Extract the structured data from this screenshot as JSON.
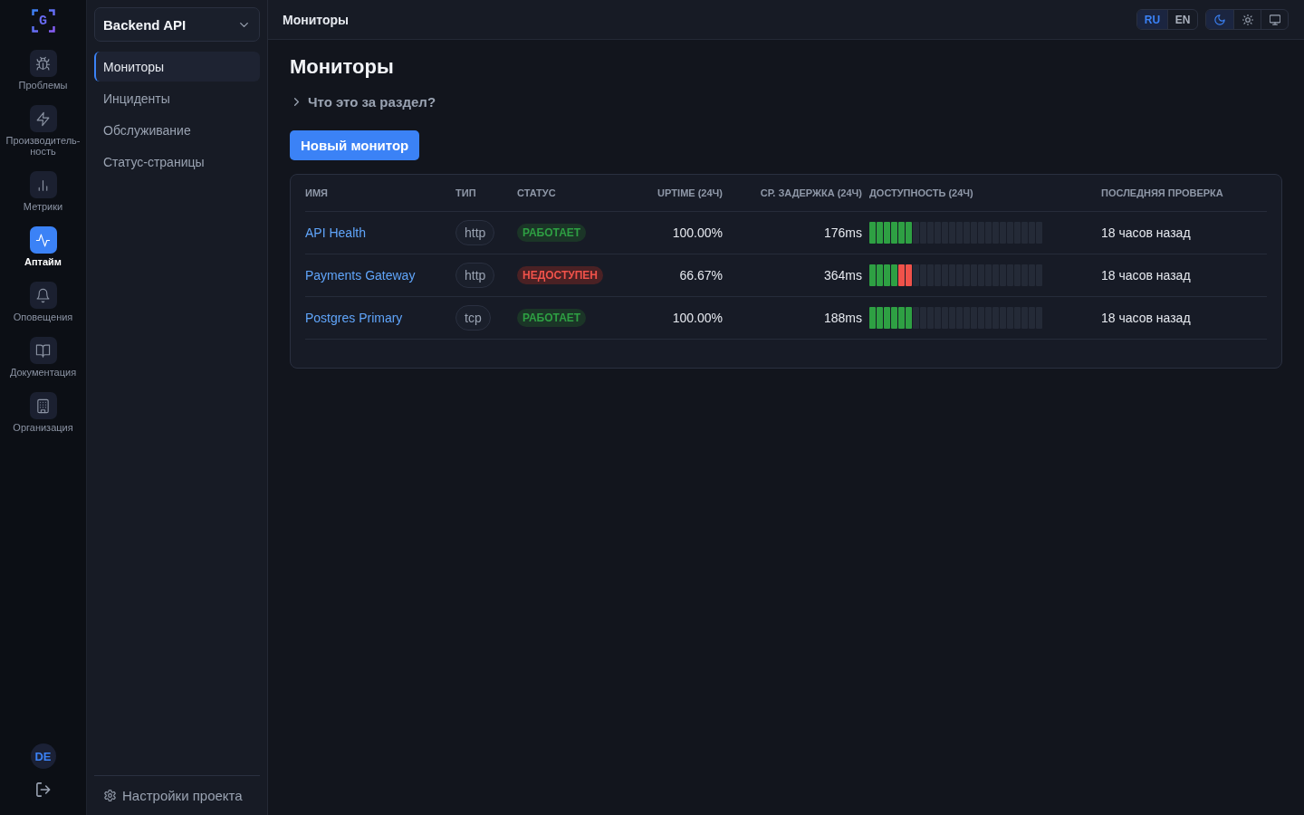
{
  "rail": {
    "logo": "G",
    "items": [
      {
        "label": "Проблемы",
        "selected": false
      },
      {
        "label": "Производитель-ность",
        "selected": false
      },
      {
        "label": "Метрики",
        "selected": false
      },
      {
        "label": "Аптайм",
        "selected": true
      },
      {
        "label": "Оповещения",
        "selected": false
      },
      {
        "label": "Документация",
        "selected": false
      },
      {
        "label": "Организация",
        "selected": false
      }
    ],
    "avatar": "DE"
  },
  "sidebar": {
    "project": "Backend API",
    "items": [
      {
        "label": "Мониторы",
        "selected": true
      },
      {
        "label": "Инциденты",
        "selected": false
      },
      {
        "label": "Обслуживание",
        "selected": false
      },
      {
        "label": "Статус-страницы",
        "selected": false
      }
    ],
    "settings": "Настройки проекта"
  },
  "header": {
    "title": "Мониторы",
    "languages": [
      {
        "label": "RU",
        "selected": true
      },
      {
        "label": "EN",
        "selected": false
      }
    ],
    "theme_modes": [
      {
        "selected": true
      },
      {
        "selected": false
      },
      {
        "selected": false
      }
    ]
  },
  "page": {
    "title": "Мониторы",
    "help": {
      "label": "Что это за раздел?",
      "expanded": false
    },
    "new_button": "Новый монитор"
  },
  "table": {
    "columns": [
      "ИМЯ",
      "ТИП",
      "СТАТУС",
      "UPTIME (24Ч)",
      "СР. ЗАДЕРЖКА (24Ч)",
      "ДОСТУПНОСТЬ (24Ч)",
      "ПОСЛЕДНЯЯ ПРОВЕРКА"
    ],
    "rows": [
      {
        "name": "API Health",
        "type": "http",
        "status": {
          "label": "РАБОТАЕТ",
          "kind": "up"
        },
        "uptime": "100.00%",
        "latency": "176ms",
        "availability": [
          {
            "kind": "up"
          },
          {
            "kind": "up"
          },
          {
            "kind": "up"
          },
          {
            "kind": "up"
          },
          {
            "kind": "up"
          },
          {
            "kind": "up"
          },
          {
            "kind": "none"
          },
          {
            "kind": "none"
          },
          {
            "kind": "none"
          },
          {
            "kind": "none"
          },
          {
            "kind": "none"
          },
          {
            "kind": "none"
          },
          {
            "kind": "none"
          },
          {
            "kind": "none"
          },
          {
            "kind": "none"
          },
          {
            "kind": "none"
          },
          {
            "kind": "none"
          },
          {
            "kind": "none"
          },
          {
            "kind": "none"
          },
          {
            "kind": "none"
          },
          {
            "kind": "none"
          },
          {
            "kind": "none"
          },
          {
            "kind": "none"
          },
          {
            "kind": "none"
          }
        ],
        "last_check": "18 часов назад"
      },
      {
        "name": "Payments Gateway",
        "type": "http",
        "status": {
          "label": "НЕДОСТУПЕН",
          "kind": "down"
        },
        "uptime": "66.67%",
        "latency": "364ms",
        "availability": [
          {
            "kind": "up"
          },
          {
            "kind": "up"
          },
          {
            "kind": "up"
          },
          {
            "kind": "up"
          },
          {
            "kind": "down"
          },
          {
            "kind": "down"
          },
          {
            "kind": "none"
          },
          {
            "kind": "none"
          },
          {
            "kind": "none"
          },
          {
            "kind": "none"
          },
          {
            "kind": "none"
          },
          {
            "kind": "none"
          },
          {
            "kind": "none"
          },
          {
            "kind": "none"
          },
          {
            "kind": "none"
          },
          {
            "kind": "none"
          },
          {
            "kind": "none"
          },
          {
            "kind": "none"
          },
          {
            "kind": "none"
          },
          {
            "kind": "none"
          },
          {
            "kind": "none"
          },
          {
            "kind": "none"
          },
          {
            "kind": "none"
          },
          {
            "kind": "none"
          }
        ],
        "last_check": "18 часов назад"
      },
      {
        "name": "Postgres Primary",
        "type": "tcp",
        "status": {
          "label": "РАБОТАЕТ",
          "kind": "up"
        },
        "uptime": "100.00%",
        "latency": "188ms",
        "availability": [
          {
            "kind": "up"
          },
          {
            "kind": "up"
          },
          {
            "kind": "up"
          },
          {
            "kind": "up"
          },
          {
            "kind": "up"
          },
          {
            "kind": "up"
          },
          {
            "kind": "none"
          },
          {
            "kind": "none"
          },
          {
            "kind": "none"
          },
          {
            "kind": "none"
          },
          {
            "kind": "none"
          },
          {
            "kind": "none"
          },
          {
            "kind": "none"
          },
          {
            "kind": "none"
          },
          {
            "kind": "none"
          },
          {
            "kind": "none"
          },
          {
            "kind": "none"
          },
          {
            "kind": "none"
          },
          {
            "kind": "none"
          },
          {
            "kind": "none"
          },
          {
            "kind": "none"
          },
          {
            "kind": "none"
          },
          {
            "kind": "none"
          },
          {
            "kind": "none"
          }
        ],
        "last_check": "18 часов назад"
      }
    ]
  }
}
